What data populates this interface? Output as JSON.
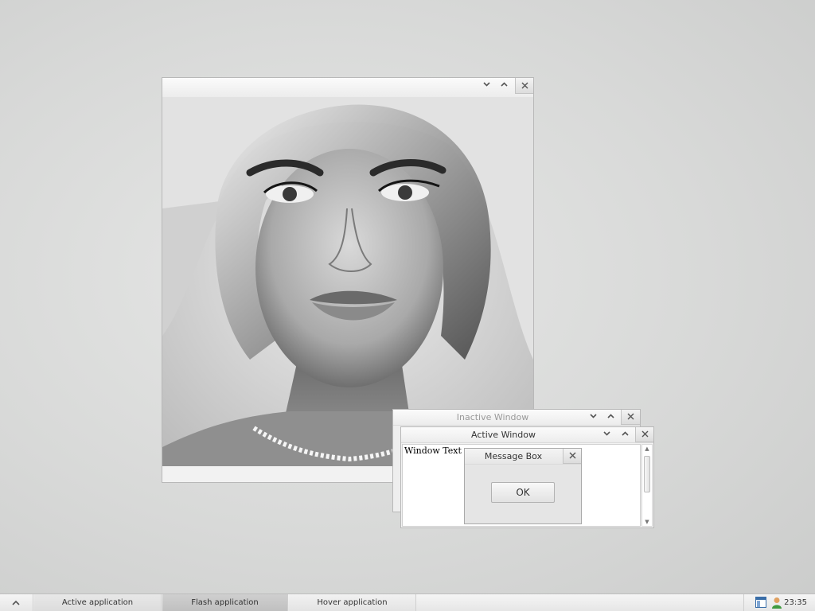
{
  "image_window": {
    "title": "",
    "controls": {
      "minimize": "chevron-down-icon",
      "maximize": "chevron-up-icon",
      "close": "close-icon"
    },
    "content": "black-and-white portrait photo"
  },
  "inactive_window": {
    "title": "Inactive Window",
    "controls": {
      "minimize": "chevron-down-icon",
      "maximize": "chevron-up-icon",
      "close": "close-icon"
    }
  },
  "active_window": {
    "title": "Active Window",
    "text": "Window Text",
    "controls": {
      "minimize": "chevron-down-icon",
      "maximize": "chevron-up-icon",
      "close": "close-icon"
    }
  },
  "message_box": {
    "title": "Message Box",
    "ok_label": "OK"
  },
  "taskbar": {
    "start_icon": "chevron-up-icon",
    "tasks": [
      {
        "label": "Active application",
        "state": "active"
      },
      {
        "label": "Flash application",
        "state": "flash"
      },
      {
        "label": "Hover application",
        "state": "hover"
      }
    ],
    "tray": {
      "icons": [
        "window-list-icon",
        "user-icon"
      ],
      "clock": "23:35"
    }
  },
  "colors": {
    "desktop": "#d8d9d8",
    "window_bg": "#f2f2f2",
    "title_active": "#333333",
    "title_inactive": "#9a9a9a",
    "taskbar": "#ececec"
  }
}
